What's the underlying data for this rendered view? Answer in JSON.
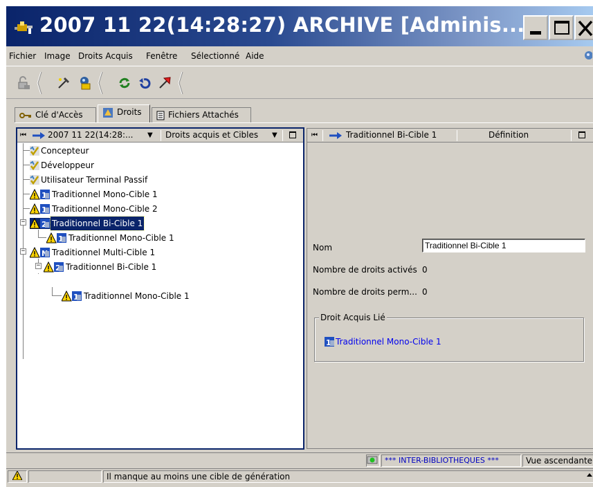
{
  "window": {
    "title": "2007 11 22(14:28:27) ARCHIVE [Adminis...",
    "title_bg": "#0a246a",
    "minimize_glyph": "_",
    "maximize_glyph": "□",
    "close_glyph": "X"
  },
  "menu": {
    "items": [
      "Fichier",
      "Image",
      "Droits Acquis",
      "Fenêtre",
      "Sélectionné",
      "Aide"
    ]
  },
  "toolbar": {
    "icons": [
      "lock-icon",
      "wand-icon",
      "stamp-icon",
      "refresh-icon",
      "undo-icon",
      "arrow-icon"
    ]
  },
  "tabs": [
    {
      "label": "Clé d'Accès",
      "icon": "key-icon"
    },
    {
      "label": "Droits",
      "icon": "rights-icon"
    },
    {
      "label": "Fichiers Attachés",
      "icon": "document-icon"
    }
  ],
  "left_panel": {
    "nav_glyph": "⏮",
    "date_dropdown": "2007 11 22(14:28:...",
    "view_dropdown": "Droits acquis et Cibles",
    "dropdown_arrow": "▼",
    "tree": [
      {
        "label": "Concepteur",
        "icon": "user-check-icon"
      },
      {
        "label": "Développeur",
        "icon": "user-check-icon"
      },
      {
        "label": "Utilisateur Terminal Passif",
        "icon": "user-check-icon"
      },
      {
        "label": "Traditionnel Mono-Cible 1",
        "icon": "warning-mono-icon"
      },
      {
        "label": "Traditionnel Mono-Cible 2",
        "icon": "warning-mono-icon"
      },
      {
        "label": "Traditionnel Bi-Cible 1",
        "icon": "warning-bi-icon",
        "selected": true
      },
      {
        "label": "Traditionnel Mono-Cible 1",
        "icon": "warning-mono-icon"
      },
      {
        "label": "Traditionnel Multi-Cible 1",
        "icon": "warning-multi-icon"
      },
      {
        "label": "Traditionnel Bi-Cible 1",
        "icon": "warning-bi-icon"
      },
      {
        "label": "Traditionnel Mono-Cible 1",
        "icon": "warning-mono-icon"
      }
    ],
    "toggle_minus": "−"
  },
  "right_panel": {
    "nav_glyph": "⏮",
    "title": "Traditionnel Bi-Cible 1",
    "column": "Définition",
    "fields": {
      "nom_label": "Nom",
      "nom_value": "Traditionnel Bi-Cible 1",
      "actives_label": "Nombre de droits activés",
      "actives_value": "0",
      "perm_label": "Nombre de droits perm...",
      "perm_value": "0"
    },
    "group": {
      "title": "Droit Acquis Lié",
      "link": "Traditionnel Mono-Cible 1",
      "link_color": "#0000ee"
    }
  },
  "status": {
    "inter": "*** INTER-BIBLIOTHEQUES ***",
    "inter_color": "#0000c0",
    "view": "Vue ascendante",
    "message": "Il manque au moins une cible de génération"
  },
  "colors": {
    "face": "#d4d0c8",
    "selection": "#0a246a",
    "warning": "#ffd400"
  }
}
